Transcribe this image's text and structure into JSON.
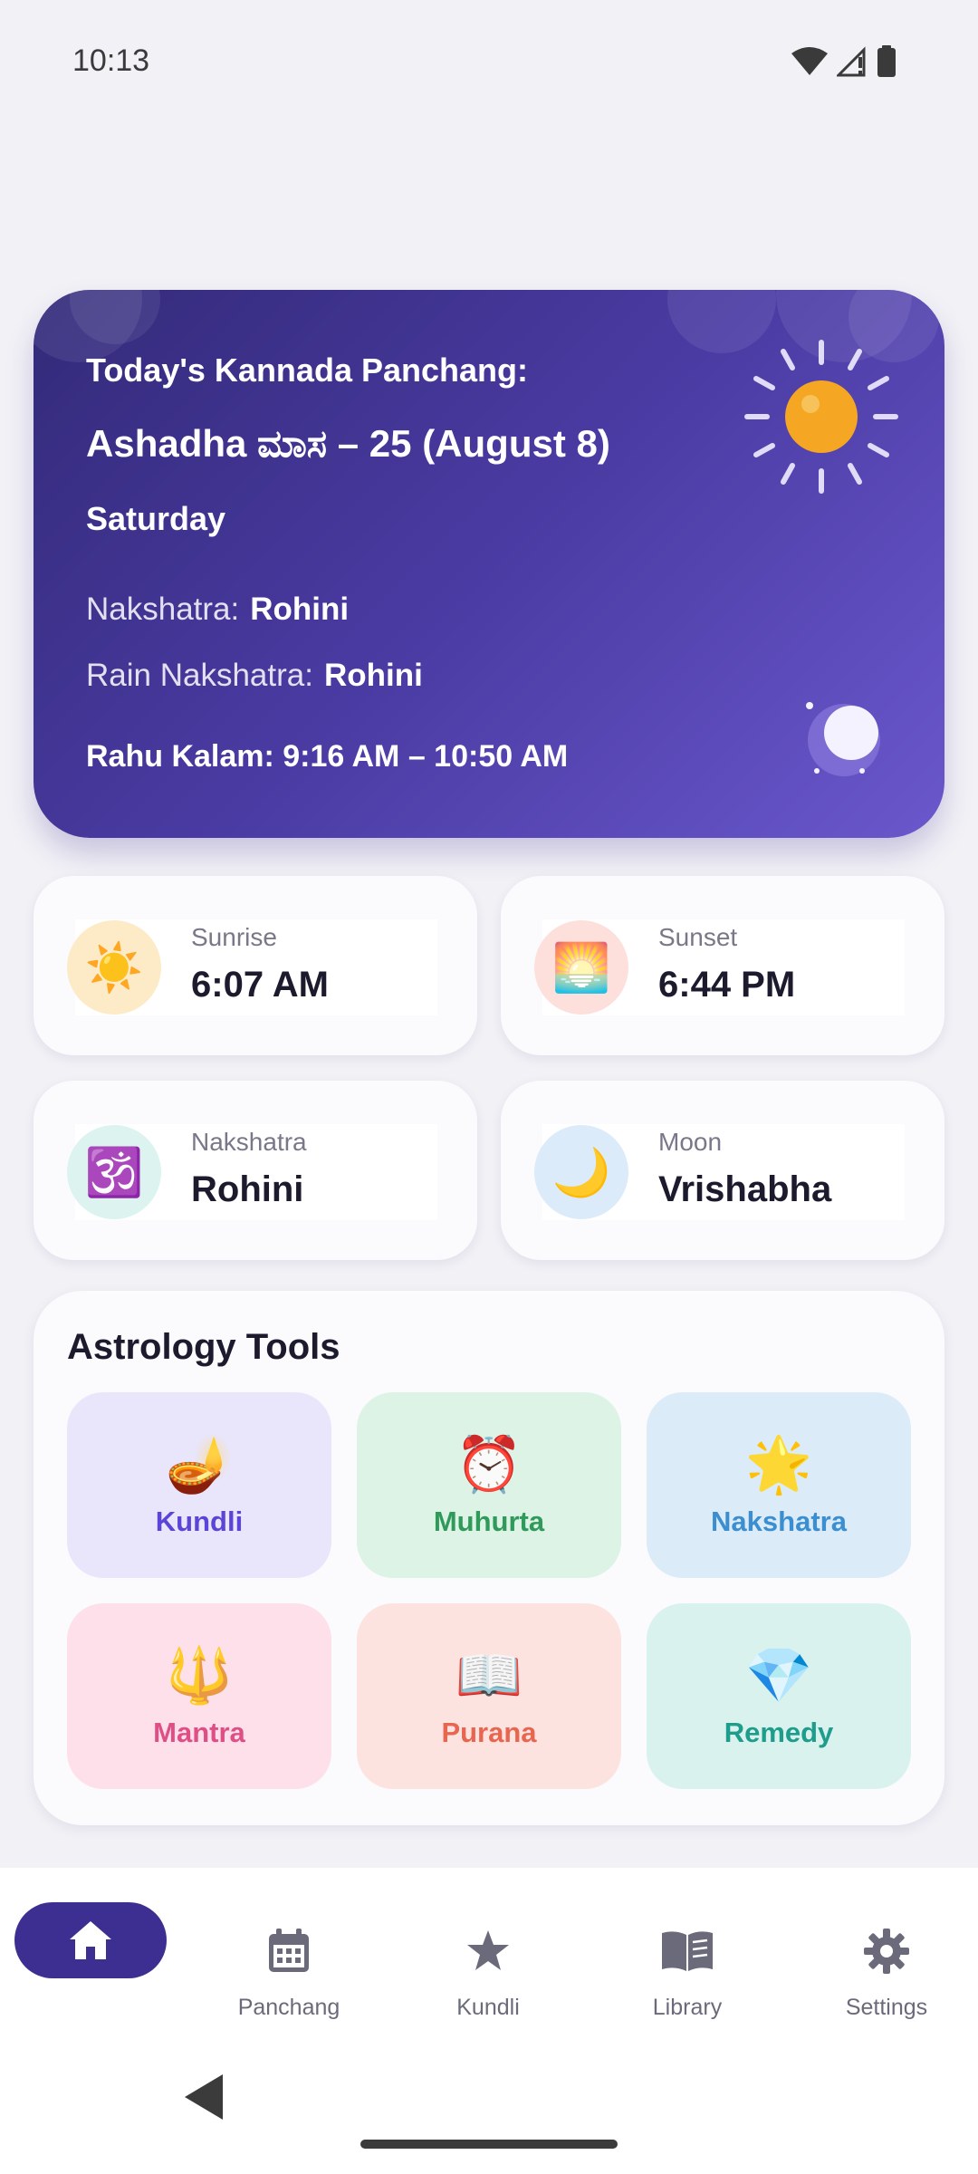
{
  "status": {
    "time": "10:13"
  },
  "hero": {
    "heading": "Today's Kannada Panchang:",
    "title": "Ashadha ಮಾಸ – 25 (August 8)",
    "weekday": "Saturday",
    "nakshatra_label": "Nakshatra:",
    "nakshatra_value": "Rohini",
    "rain_label": "Rain Nakshatra:",
    "rain_value": "Rohini",
    "rahu": "Rahu Kalam: 9:16 AM – 10:50 AM"
  },
  "info_cards": [
    {
      "label": "Sunrise",
      "value": "6:07 AM",
      "icon": "☀️",
      "icon_name": "sun-icon",
      "icon_bg": "#fdebc8"
    },
    {
      "label": "Sunset",
      "value": "6:44 PM",
      "icon": "🌅",
      "icon_name": "sunset-icon",
      "icon_bg": "#fde0dc"
    },
    {
      "label": "Nakshatra",
      "value": "Rohini",
      "icon": "🕉️",
      "icon_name": "om-icon",
      "icon_bg": "#dcf3ef"
    },
    {
      "label": "Moon",
      "value": "Vrishabha",
      "icon": "🌙",
      "icon_name": "crescent-moon-icon",
      "icon_bg": "#dcebf9"
    }
  ],
  "tools": {
    "title": "Astrology Tools",
    "items": [
      {
        "label": "Kundli",
        "icon": "🪔",
        "icon_name": "diya-lamp-icon",
        "bg": "#e9e6fb",
        "color": "#5b45d6"
      },
      {
        "label": "Muhurta",
        "icon": "⏰",
        "icon_name": "alarm-clock-icon",
        "bg": "#ddf3e6",
        "color": "#2f9a5a"
      },
      {
        "label": "Nakshatra",
        "icon": "🌟",
        "icon_name": "glowing-star-icon",
        "bg": "#dcebf8",
        "color": "#3b8fd0"
      },
      {
        "label": "Mantra",
        "icon": "🔱",
        "icon_name": "trident-icon",
        "bg": "#fde0ea",
        "color": "#df4f86"
      },
      {
        "label": "Purana",
        "icon": "📖",
        "icon_name": "open-book-icon",
        "bg": "#fde3df",
        "color": "#e8654f"
      },
      {
        "label": "Remedy",
        "icon": "💎",
        "icon_name": "gem-icon",
        "bg": "#d9f2ee",
        "color": "#1e9c8c"
      }
    ]
  },
  "nav": {
    "items": [
      {
        "label": "",
        "icon_name": "home-icon"
      },
      {
        "label": "Panchang",
        "icon_name": "calendar-icon"
      },
      {
        "label": "Kundli",
        "icon_name": "star-icon"
      },
      {
        "label": "Library",
        "icon_name": "book-icon"
      },
      {
        "label": "Settings",
        "icon_name": "gear-icon"
      }
    ]
  },
  "colors": {
    "accent": "#3d2f91",
    "hero_start": "#332a79",
    "hero_end": "#6a58cc",
    "sun": "#f5a623"
  }
}
